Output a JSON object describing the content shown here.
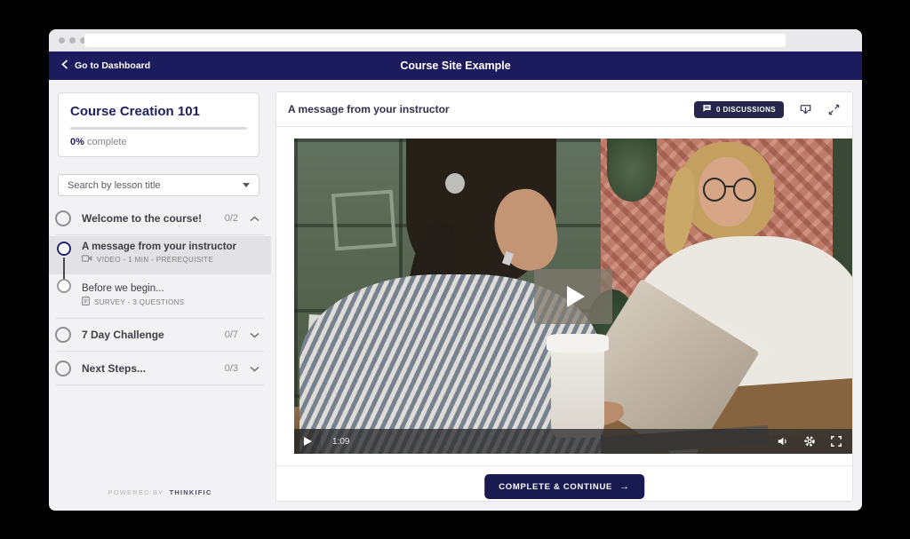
{
  "top_nav": {
    "back_label": "Go to Dashboard",
    "title": "Course Site Example"
  },
  "sidebar": {
    "course_card": {
      "title": "Course Creation 101",
      "progress_value": "0%",
      "progress_label": "complete"
    },
    "search": {
      "placeholder": "Search by lesson title"
    },
    "sections": [
      {
        "label": "Welcome to the course!",
        "count": "0/2",
        "state": "expanded"
      },
      {
        "label": "7 Day Challenge",
        "count": "0/7",
        "state": "collapsed"
      },
      {
        "label": "Next Steps...",
        "count": "0/3",
        "state": "collapsed"
      }
    ],
    "lessons": [
      {
        "title": "A message from your instructor",
        "meta": "VIDEO - 1 MIN - PREREQUISITE",
        "selected": true
      },
      {
        "title": "Before we begin...",
        "meta": "SURVEY - 3 QUESTIONS",
        "selected": false
      }
    ],
    "footer": {
      "prefix": "POWERED BY",
      "brand": "THINKIFIC"
    }
  },
  "main": {
    "lesson_title": "A message from your instructor",
    "discussions": {
      "label": "0 DISCUSSIONS"
    },
    "player": {
      "time": "1:09"
    },
    "complete_button": {
      "label": "COMPLETE & CONTINUE",
      "arrow": "→"
    }
  },
  "icons": {
    "back": "chevron-left",
    "discussions": "chat-bubble",
    "download": "download",
    "expand": "expand-arrows",
    "dropdown": "caret-down",
    "section_open": "chevron-up",
    "section_closed": "chevron-down",
    "lesson_video": "video-camera",
    "lesson_survey": "survey-doc",
    "play": "play-triangle",
    "volume": "speaker",
    "settings": "gear",
    "fullscreen": "fullscreen-brackets"
  },
  "colors": {
    "navy": "#1b1b5e",
    "button_navy": "#181a50",
    "page_bg": "#f2f2f4",
    "selected_row": "#e2e2e4"
  }
}
